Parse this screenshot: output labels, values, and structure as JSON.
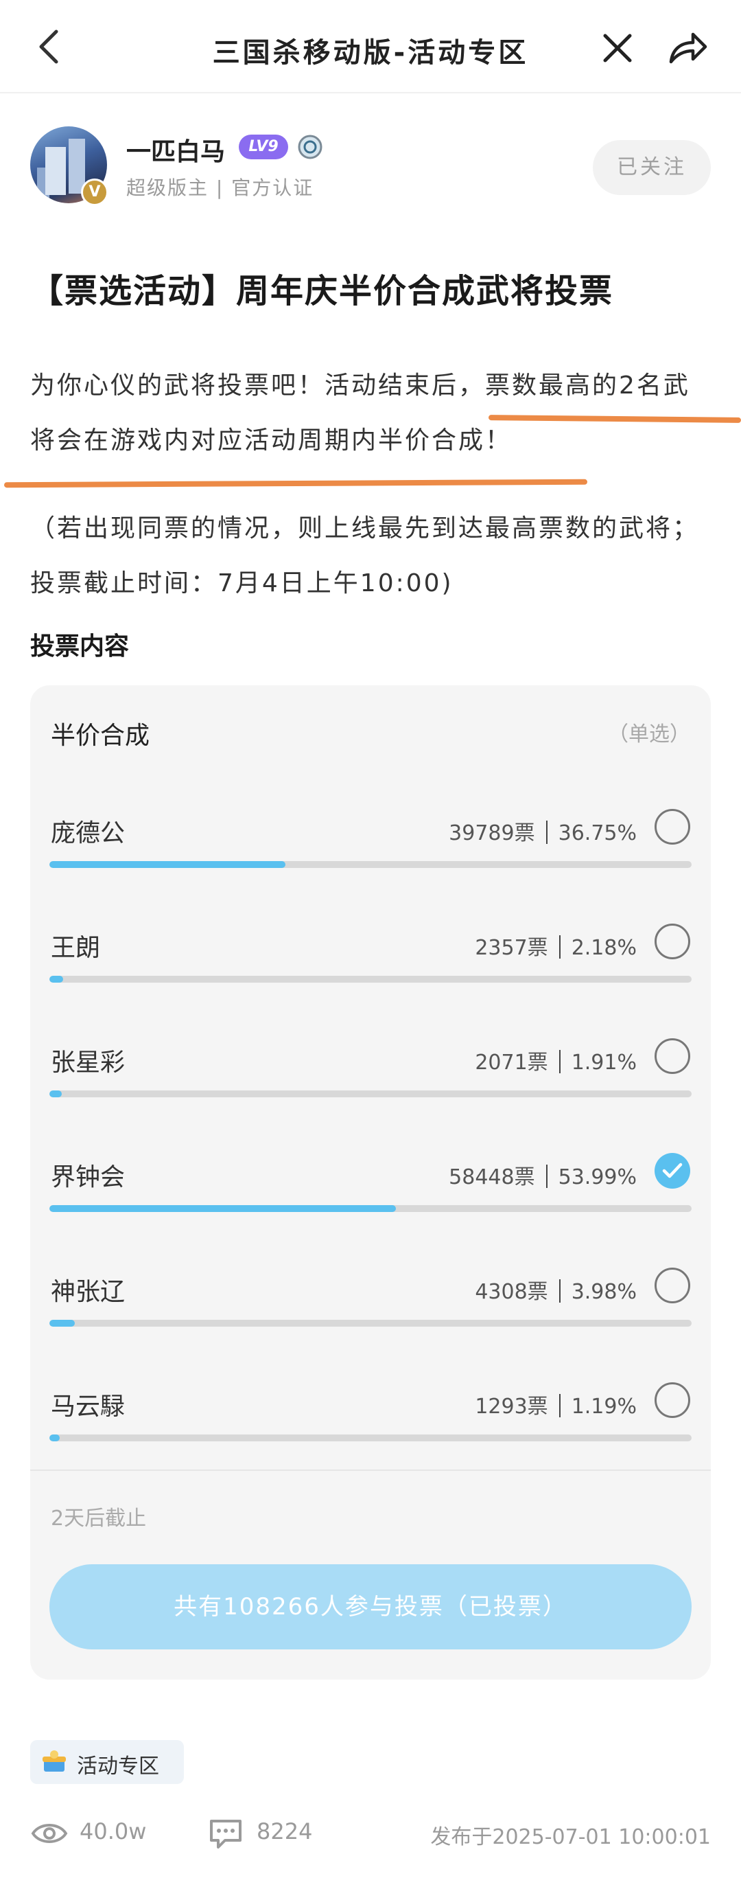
{
  "nav": {
    "title": "三国杀移动版-活动专区",
    "back_icon": "chevron-left-icon",
    "close_icon": "close-icon",
    "share_icon": "share-icon"
  },
  "author": {
    "name": "一匹白马",
    "level": "LV9",
    "avatar_badge": "V",
    "role": "超级版主 | 官方认证",
    "follow_label": "已关注"
  },
  "post": {
    "title": "【票选活动】周年庆半价合成武将投票",
    "paragraph1": "为你心仪的武将投票吧！活动结束后，票数最高的2名武将会在游戏内对应活动周期内半价合成！",
    "paragraph2": "（若出现同票的情况，则上线最先到达最高票数的武将；投票截止时间：7月4日上午10:00)",
    "section_title": "投票内容",
    "highlight_color": "#ec8a46"
  },
  "poll": {
    "title": "半价合成",
    "type": "（单选）",
    "accent_color": "#5ac0ef",
    "options": [
      {
        "name": "庞德公",
        "votes": "39789票",
        "percent": "36.75%",
        "fraction": 0.3675,
        "checked": false
      },
      {
        "name": "王朗",
        "votes": "2357票",
        "percent": "2.18%",
        "fraction": 0.0218,
        "checked": false
      },
      {
        "name": "张星彩",
        "votes": "2071票",
        "percent": "1.91%",
        "fraction": 0.0191,
        "checked": false
      },
      {
        "name": "界钟会",
        "votes": "58448票",
        "percent": "53.99%",
        "fraction": 0.5399,
        "checked": true
      },
      {
        "name": "神张辽",
        "votes": "4308票",
        "percent": "3.98%",
        "fraction": 0.0398,
        "checked": false
      },
      {
        "name": "马云騄",
        "votes": "1293票",
        "percent": "1.19%",
        "fraction": 0.0119,
        "checked": false
      }
    ],
    "deadline": "2天后截止",
    "button_label": "共有108266人参与投票（已投票）"
  },
  "tag": {
    "label": "活动专区",
    "icon": "activity-zone-icon"
  },
  "footer": {
    "views": "40.0w",
    "comments": "8224",
    "published": "发布于2025-07-01 10:00:01"
  }
}
